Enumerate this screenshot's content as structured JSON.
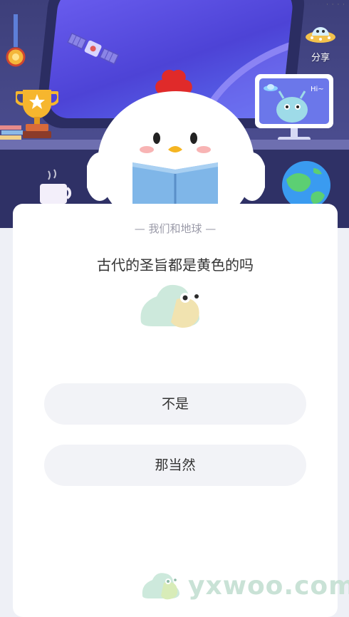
{
  "header": {
    "share_label": "分享",
    "monitor_bubble": "Hi~"
  },
  "quiz": {
    "category": "— 我们和地球 —",
    "question": "古代的圣旨都是黄色的吗",
    "answers": [
      {
        "label": "不是"
      },
      {
        "label": "那当然"
      }
    ]
  },
  "watermark": {
    "text": "yxwoo.com"
  },
  "colors": {
    "scene_bg": "#3d3f7a",
    "window_glass": "#4d43d6",
    "card_bg": "#ffffff",
    "answer_bg": "#f2f3f7",
    "category_text": "#9a9aa8",
    "question_text": "#333333"
  }
}
